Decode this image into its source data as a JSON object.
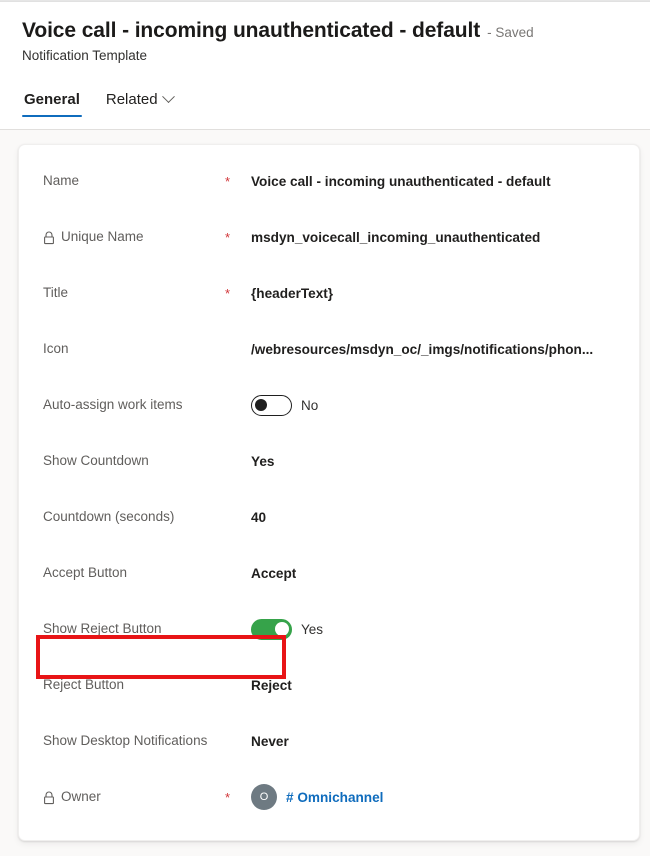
{
  "header": {
    "title": "Voice call - incoming unauthenticated - default",
    "save_state": "- Saved",
    "entity_type": "Notification Template",
    "tabs": [
      {
        "label": "General",
        "active": true,
        "has_chevron": false
      },
      {
        "label": "Related",
        "active": false,
        "has_chevron": true,
        "chevron_icon": "chevron-down-icon"
      }
    ]
  },
  "form": {
    "fields": [
      {
        "label": "Name",
        "required": true,
        "locked": false,
        "type": "text",
        "value": "Voice call - incoming unauthenticated - default"
      },
      {
        "label": "Unique Name",
        "required": true,
        "locked": true,
        "lock_icon": "lock-icon",
        "type": "text",
        "value": "msdyn_voicecall_incoming_unauthenticated"
      },
      {
        "label": "Title",
        "required": true,
        "locked": false,
        "type": "text",
        "value": "{headerText}"
      },
      {
        "label": "Icon",
        "required": false,
        "locked": false,
        "type": "text",
        "value": "/webresources/msdyn_oc/_imgs/notifications/phon..."
      },
      {
        "label": "Auto-assign work items",
        "required": false,
        "locked": false,
        "type": "toggle",
        "toggle_state": "off",
        "value": "No"
      },
      {
        "label": "Show Countdown",
        "required": false,
        "locked": false,
        "type": "text",
        "value": "Yes"
      },
      {
        "label": "Countdown (seconds)",
        "required": false,
        "locked": false,
        "type": "text",
        "value": "40",
        "highlighted": true
      },
      {
        "label": "Accept Button",
        "required": false,
        "locked": false,
        "type": "text",
        "value": "Accept"
      },
      {
        "label": "Show Reject Button",
        "required": false,
        "locked": false,
        "type": "toggle",
        "toggle_state": "on",
        "value": "Yes"
      },
      {
        "label": "Reject Button",
        "required": false,
        "locked": false,
        "type": "text",
        "value": "Reject"
      },
      {
        "label": "Show Desktop Notifications",
        "required": false,
        "locked": false,
        "type": "text",
        "value": "Never"
      },
      {
        "label": "Owner",
        "required": true,
        "locked": true,
        "lock_icon": "lock-icon",
        "type": "lookup",
        "avatar_initial": "O",
        "value": "# Omnichannel"
      }
    ]
  },
  "colors": {
    "accent": "#0f6cbd",
    "required_star": "#d13438",
    "toggle_on": "#36a34a",
    "annotation": "#e81416",
    "page_background": "#faf9f8",
    "avatar": "#6e7a82"
  },
  "annotation": {
    "target_field": "Countdown (seconds)",
    "shape": "rectangle"
  }
}
